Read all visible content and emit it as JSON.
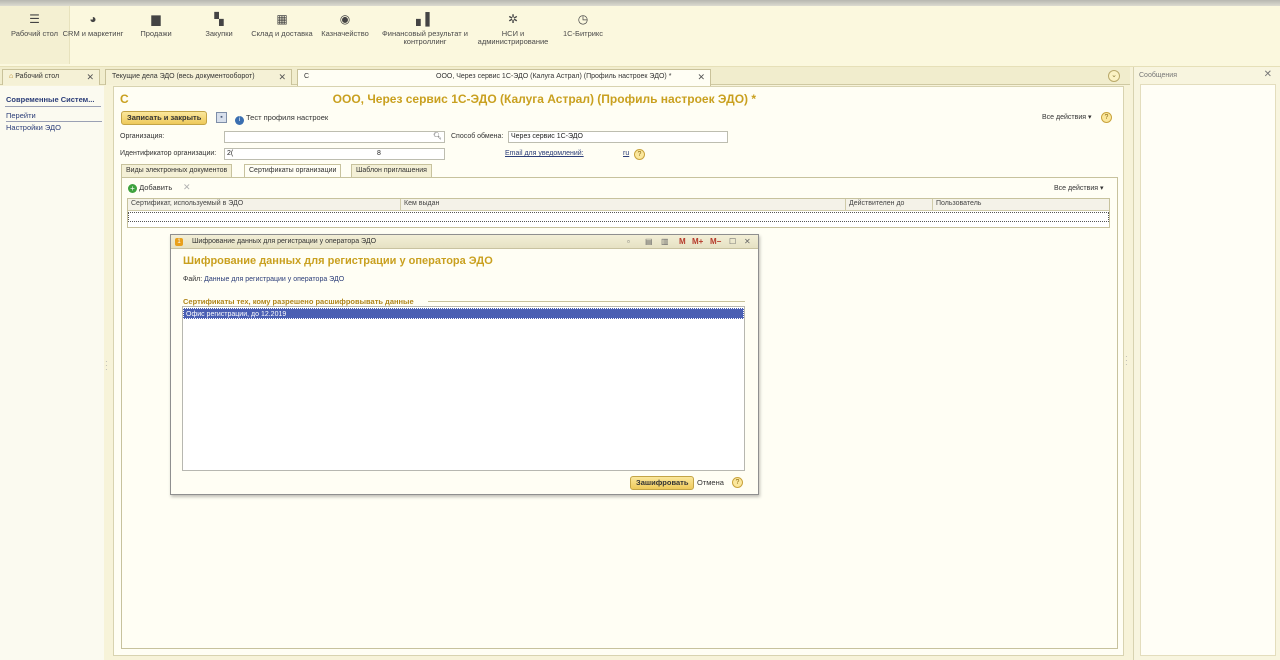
{
  "sections": [
    {
      "label": "Рабочий стол",
      "icon": "menu-icon",
      "glyph": "☰"
    },
    {
      "label": "CRM и маркетинг",
      "icon": "pie-chart-icon",
      "glyph": "◕"
    },
    {
      "label": "Продажи",
      "icon": "shopping-bag-icon",
      "glyph": "▆"
    },
    {
      "label": "Закупки",
      "icon": "cart-icon",
      "glyph": "▚"
    },
    {
      "label": "Склад и доставка",
      "icon": "warehouse-icon",
      "glyph": "▦"
    },
    {
      "label": "Казначейство",
      "icon": "coin-icon",
      "glyph": "◉"
    },
    {
      "label": "Финансовый результат и контроллинг",
      "icon": "bar-chart-icon",
      "glyph": "▖▌"
    },
    {
      "label": "НСИ и администрирование",
      "icon": "gear-icon",
      "glyph": "✲"
    },
    {
      "label": "1С-Битрикс",
      "icon": "clock-icon",
      "glyph": "◷"
    }
  ],
  "tabs": {
    "home_label": "Рабочий стол",
    "current_edo_label": "Текущие дела ЭДО (весь документооборот)",
    "profile_prefix": "С",
    "profile_label": "ООО, Через сервис 1С-ЭДО (Калуга Астрал) (Профиль настроек ЭДО) *",
    "close": "✕",
    "more": "⌄"
  },
  "leftpanel": {
    "org_name": "Современные Систем...",
    "go_label": "Перейти",
    "link_label": "Настройки ЭДО"
  },
  "form": {
    "title_prefix": "С",
    "title": "ООО, Через сервис 1С-ЭДО (Калуга Астрал) (Профиль настроек ЭДО) *",
    "save_close": "Записать и закрыть",
    "test_profile": "Тест профиля настроек",
    "all_actions": "Все действия ▾",
    "org_label": "Организация:",
    "org_value": "",
    "exchange_label": "Способ обмена:",
    "exchange_value": "Через сервис 1С-ЭДО",
    "id_label": "Идентификатор организации:",
    "id_value_start": "2(",
    "id_value_end": "8",
    "email_label": "Email для уведомлений:",
    "email_value": "ru",
    "help": "?"
  },
  "inner_tabs": [
    "Виды электронных документов",
    "Сертификаты организации",
    "Шаблон приглашения"
  ],
  "cert_table": {
    "add_label": "Добавить",
    "all_actions": "Все действия ▾",
    "columns": [
      "Сертификат, используемый в ЭДО",
      "Кем выдан",
      "Действителен до",
      "Пользователь"
    ]
  },
  "messages": {
    "title": "Сообщения",
    "close": "✕"
  },
  "dialog": {
    "window_title": "Шифрование данных для регистрации у оператора ЭДО",
    "heading": "Шифрование данных для регистрации у оператора ЭДО",
    "file_label": "Файл:",
    "file_link": "Данные для регистрации у оператора ЭДО",
    "group_title": "Сертификаты тех, кому разрешено расшифровывать данные",
    "certificates": [
      "Офис регистрации, до 12.2019"
    ],
    "encrypt_button": "Зашифровать",
    "cancel_button": "Отмена",
    "ctl_m": "M",
    "ctl_mplus": "M+",
    "ctl_mminus": "M−",
    "ctl_max": "☐",
    "ctl_close": "✕"
  }
}
